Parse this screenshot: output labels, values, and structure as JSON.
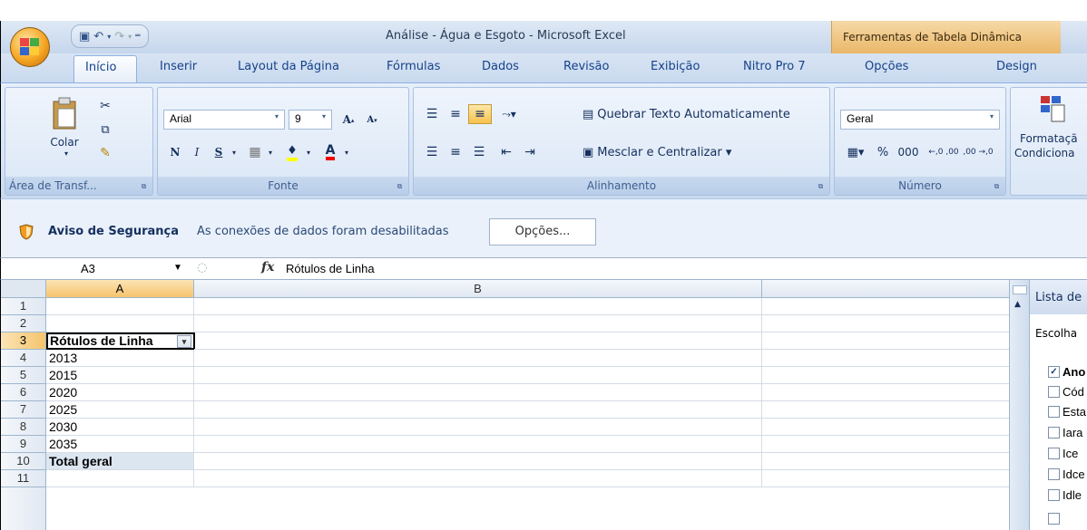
{
  "window": {
    "title": "Análise - Água e Esgoto - Microsoft Excel",
    "context_tab_group": "Ferramentas de Tabela Dinâmica"
  },
  "tabs": [
    {
      "label": "Início",
      "active": true
    },
    {
      "label": "Inserir"
    },
    {
      "label": "Layout da Página"
    },
    {
      "label": "Fórmulas"
    },
    {
      "label": "Dados"
    },
    {
      "label": "Revisão"
    },
    {
      "label": "Exibição"
    },
    {
      "label": "Nitro Pro 7"
    },
    {
      "label": "Opções"
    },
    {
      "label": "Design"
    }
  ],
  "ribbon": {
    "clipboard": {
      "label": "Área de Transf...",
      "paste": "Colar"
    },
    "font": {
      "label": "Fonte",
      "name": "Arial",
      "size": "9",
      "bold": "N",
      "italic": "I",
      "underline": "S"
    },
    "alignment": {
      "label": "Alinhamento",
      "wrap": "Quebrar Texto Automaticamente",
      "merge": "Mesclar e Centralizar ▾"
    },
    "number": {
      "label": "Número",
      "format": "Geral",
      "percent": "%",
      "thousands": "000",
      "inc_dec": "←,0 ,00",
      "dec_dec": ",00 →,0"
    },
    "styles": {
      "cond_format_l1": "Formataçã",
      "cond_format_l2": "Condiciona"
    }
  },
  "security": {
    "title": "Aviso de Segurança",
    "message": "As conexões de dados foram desabilitadas",
    "button": "Opções..."
  },
  "formula_bar": {
    "name_box": "A3",
    "fx": "fx",
    "value": "Rótulos de Linha"
  },
  "sheet": {
    "columns": [
      "A",
      "B"
    ],
    "rows": [
      {
        "n": "1",
        "a": ""
      },
      {
        "n": "2",
        "a": ""
      },
      {
        "n": "3",
        "a": "Rótulos de Linha"
      },
      {
        "n": "4",
        "a": "2013"
      },
      {
        "n": "5",
        "a": "2015"
      },
      {
        "n": "6",
        "a": "2020"
      },
      {
        "n": "7",
        "a": "2025"
      },
      {
        "n": "8",
        "a": "2030"
      },
      {
        "n": "9",
        "a": "2035"
      },
      {
        "n": "10",
        "a": "Total geral"
      },
      {
        "n": "11",
        "a": ""
      }
    ],
    "filter_glyph": "▾"
  },
  "field_list": {
    "title": "Lista de",
    "choose": "Escolha",
    "fields": [
      {
        "label": "Ano",
        "checked": true,
        "mark": "✓"
      },
      {
        "label": "Cód"
      },
      {
        "label": "Esta"
      },
      {
        "label": "Iara"
      },
      {
        "label": "Ice"
      },
      {
        "label": "Idce"
      },
      {
        "label": "Idle"
      }
    ]
  }
}
